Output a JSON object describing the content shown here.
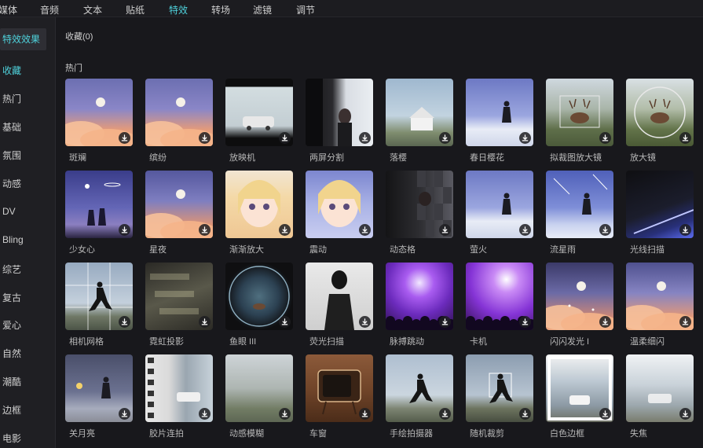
{
  "topbar": {
    "tabs": [
      {
        "label": "媒体",
        "active": false
      },
      {
        "label": "音频",
        "active": false
      },
      {
        "label": "文本",
        "active": false
      },
      {
        "label": "贴纸",
        "active": false
      },
      {
        "label": "特效",
        "active": true
      },
      {
        "label": "转场",
        "active": false
      },
      {
        "label": "滤镜",
        "active": false
      },
      {
        "label": "调节",
        "active": false
      }
    ]
  },
  "sidebar": {
    "items": [
      {
        "label": "特效效果"
      },
      {
        "label": "收藏"
      },
      {
        "label": "热门"
      },
      {
        "label": "基础"
      },
      {
        "label": "氛围"
      },
      {
        "label": "动感"
      },
      {
        "label": "DV"
      },
      {
        "label": "Bling"
      },
      {
        "label": "综艺"
      },
      {
        "label": "复古"
      },
      {
        "label": "爱心"
      },
      {
        "label": "自然"
      },
      {
        "label": "潮酷"
      },
      {
        "label": "边框"
      },
      {
        "label": "电影"
      }
    ]
  },
  "main": {
    "favorites_title": "收藏(0)",
    "hot_title": "热门"
  },
  "effects": [
    {
      "label": "斑斓",
      "theme": "cloud-star"
    },
    {
      "label": "缤纷",
      "theme": "cloud-star"
    },
    {
      "label": "放映机",
      "theme": "film-car"
    },
    {
      "label": "两屏分割",
      "theme": "split"
    },
    {
      "label": "落樱",
      "theme": "house"
    },
    {
      "label": "春日樱花",
      "theme": "girl-sky"
    },
    {
      "label": "拟裁图放大镜",
      "theme": "deer-box"
    },
    {
      "label": "放大镜",
      "theme": "deer-circle"
    },
    {
      "label": "少女心",
      "theme": "night-couple"
    },
    {
      "label": "星夜",
      "theme": "cloud-moon"
    },
    {
      "label": "渐渐放大",
      "theme": "anime"
    },
    {
      "label": "震动",
      "theme": "anime2"
    },
    {
      "label": "动态格",
      "theme": "mosaic"
    },
    {
      "label": "萤火",
      "theme": "girl-sky"
    },
    {
      "label": "流星雨",
      "theme": "meteor"
    },
    {
      "label": "光线扫描",
      "theme": "light-scan"
    },
    {
      "label": "相机网格",
      "theme": "grid-jump"
    },
    {
      "label": "霓虹投影",
      "theme": "neon"
    },
    {
      "label": "鱼眼 III",
      "theme": "fisheye"
    },
    {
      "label": "荧光扫描",
      "theme": "bw-man"
    },
    {
      "label": "脉搏跳动",
      "theme": "concert"
    },
    {
      "label": "卡机",
      "theme": "concert2"
    },
    {
      "label": "闪闪发光 I",
      "theme": "sparkle-cloud"
    },
    {
      "label": "温柔细闪",
      "theme": "cloud-moon2"
    },
    {
      "label": "关月亮",
      "theme": "moon-girl"
    },
    {
      "label": "胶片连拍",
      "theme": "film-strip"
    },
    {
      "label": "动感模糊",
      "theme": "blur"
    },
    {
      "label": "车窗",
      "theme": "tv"
    },
    {
      "label": "手绘拍摄器",
      "theme": "jump-film"
    },
    {
      "label": "随机裁剪",
      "theme": "jump-crop"
    },
    {
      "label": "白色边框",
      "theme": "white-frame"
    },
    {
      "label": "失焦",
      "theme": "car-blur"
    }
  ],
  "colors": {
    "accent": "#4fd2dc",
    "background": "#18181c",
    "sidebar": "#1f1f23"
  },
  "icons": {
    "download": "download-icon"
  }
}
